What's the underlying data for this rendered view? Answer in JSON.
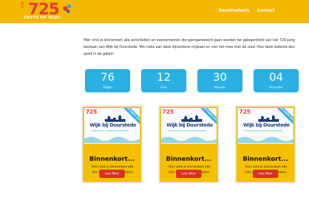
{
  "header": {
    "logo_year": "725",
    "logo_jaar": "JAAR",
    "logo_tagline": "TROTS OP WIJK!",
    "nav": [
      "Geschiedenis",
      "Contact"
    ]
  },
  "intro": {
    "text": "Hier vind je binnenkort alle activiteiten en evenementen die georganiseerd gaan worden ter gelegenheid van het 725-jarig bestaan van Wijk bij Duurstede. Mis niets van deze bijzondere mijlpaal en vier het mee met de stad. Hou deze website dus goed in de gaten!"
  },
  "countdown": [
    {
      "value": "76",
      "label": "Dagen"
    },
    {
      "value": "12",
      "label": "Uren"
    },
    {
      "value": "30",
      "label": "Minuten"
    },
    {
      "value": "04",
      "label": "Seconden"
    }
  ],
  "cards": [
    {
      "ribbon": "OKTOBER 2025",
      "image_logo": "725",
      "image_title": "Wijk bij Duurstede",
      "image_sub": "KLEINE STAD, GROTE GESCHIEDENIS",
      "title": "Binnenkort...",
      "desc": "Hier vind je binnenkort alle info over de evenementen.",
      "button": "Lees Meer"
    },
    {
      "ribbon": "OKTOBER 2025",
      "image_logo": "725",
      "image_title": "Wijk bij Duurstede",
      "image_sub": "KLEINE STAD, GROTE GESCHIEDENIS",
      "title": "Binnenkort...",
      "desc": "Hier vind je binnenkort alle info over de evenementen.",
      "button": "Lees Meer"
    },
    {
      "ribbon": "OKTOBER 2025",
      "image_logo": "725",
      "image_title": "Wijk bij Duurstede",
      "image_sub": "KLEINE STAD, GROTE GESCHIEDENIS",
      "title": "Binnenkort...",
      "desc": "Hier vind je binnenkort alle info over de evenementen.",
      "button": "Lees Meer"
    }
  ],
  "colors": {
    "header_bg": "#f5b800",
    "accent_red": "#e63b2e",
    "accent_blue": "#2bb0e4",
    "card_bg": "#f5c000",
    "button_red": "#d9302a"
  }
}
